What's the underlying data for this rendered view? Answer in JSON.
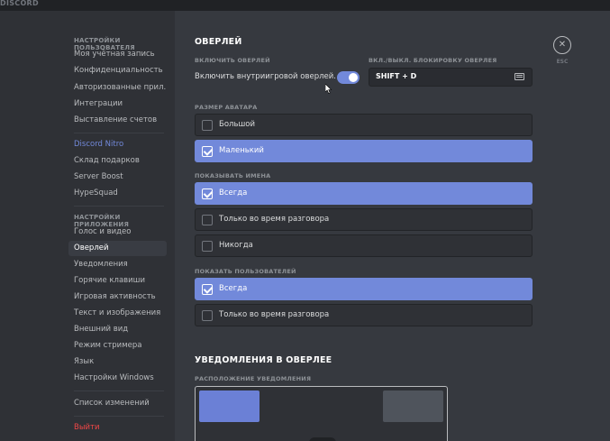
{
  "app": {
    "title": "DISCORD"
  },
  "sidebar": {
    "user_settings_header": "НАСТРОЙКИ ПОЛЬЗОВАТЕЛЯ",
    "user_items": [
      "Моя учётная запись",
      "Конфиденциальность",
      "Авторизованные прил...",
      "Интеграции",
      "Выставление счетов"
    ],
    "billing_items": [
      "Discord Nitro",
      "Склад подарков",
      "Server Boost",
      "HypeSquad"
    ],
    "app_settings_header": "НАСТРОЙКИ ПРИЛОЖЕНИЯ",
    "app_items": [
      "Голос и видео",
      "Оверлей",
      "Уведомления",
      "Горячие клавиши",
      "Игровая активность",
      "Текст и изображения",
      "Внешний вид",
      "Режим стримера",
      "Язык",
      "Настройки Windows"
    ],
    "changelog": "Список изменений",
    "logout": "Выйти",
    "active_item": "Оверлей"
  },
  "overlay": {
    "title": "ОВЕРЛЕЙ",
    "enable_header": "ВКЛЮЧИТЬ ОВЕРЛЕЙ",
    "enable_label": "Включить внутриигровой оверлей.",
    "enable_on": true,
    "keybind_header": "ВКЛ./ВЫКЛ. БЛОКИРОВКУ ОВЕРЛЕЯ",
    "keybind_value": "SHIFT + D",
    "avatar_size_header": "РАЗМЕР АВАТАРА",
    "avatar_options": [
      "Большой",
      "Маленький"
    ],
    "avatar_selected": "Маленький",
    "show_names_header": "ПОКАЗЫВАТЬ ИМЕНА",
    "names_options": [
      "Всегда",
      "Только во время разговора",
      "Никогда"
    ],
    "names_selected": "Всегда",
    "show_users_header": "ПОКАЗАТЬ ПОЛЬЗОВАТЕЛЕЙ",
    "users_options": [
      "Всегда",
      "Только во время разговора"
    ],
    "users_selected": "Всегда"
  },
  "notifications": {
    "title": "УВЕДОМЛЕНИЯ В ОВЕРЛЕЕ",
    "position_header": "РАСПОЛОЖЕНИЕ УВЕДОМЛЕНИЯ",
    "selected_position": "top-left"
  },
  "close": {
    "label": "ESC",
    "icon": "close-icon"
  },
  "colors": {
    "accent": "#7289da",
    "danger": "#f04747",
    "sidebar_bg": "#2f3136",
    "content_bg": "#36393f"
  }
}
